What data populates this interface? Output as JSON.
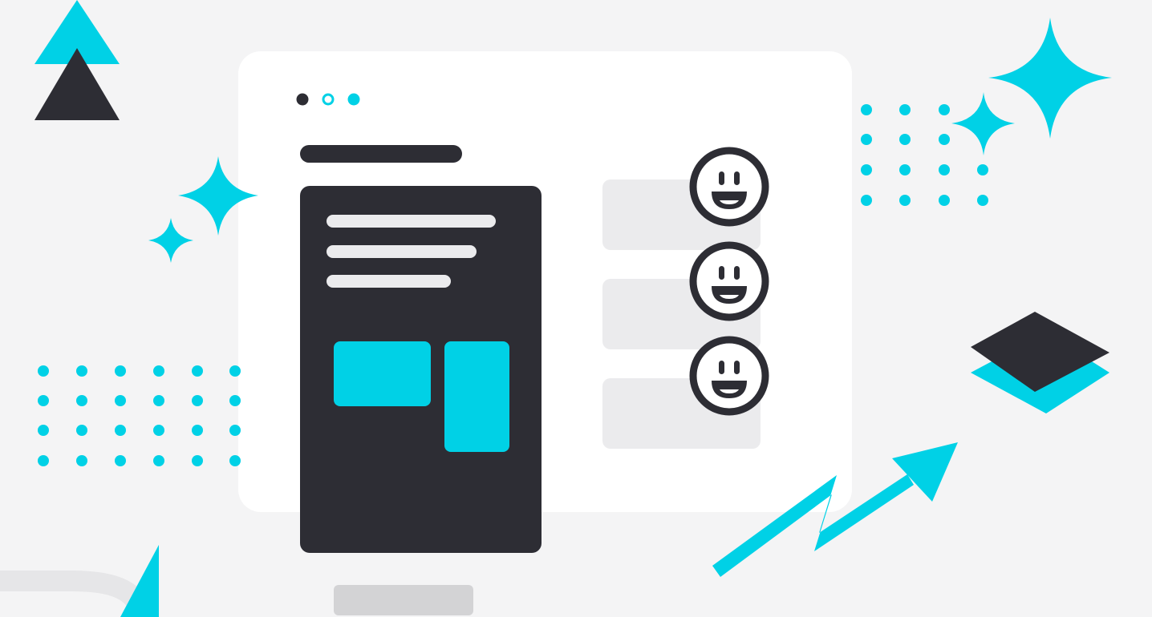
{
  "colors": {
    "background": "#f4f4f5",
    "card": "#ffffff",
    "dark": "#2d2d34",
    "accent": "#00d1e6",
    "light_gray": "#ebebed",
    "mid_gray": "#d3d3d5"
  },
  "window": {
    "dots": [
      "dark-filled",
      "accent-outline",
      "accent-filled"
    ]
  },
  "icons": {
    "emoji": [
      "smiley-icon",
      "smiley-icon",
      "smiley-icon"
    ],
    "decor": [
      "triangle-icon",
      "sparkle-icon",
      "dot-grid-icon",
      "layers-icon",
      "trend-arrow-icon"
    ]
  }
}
